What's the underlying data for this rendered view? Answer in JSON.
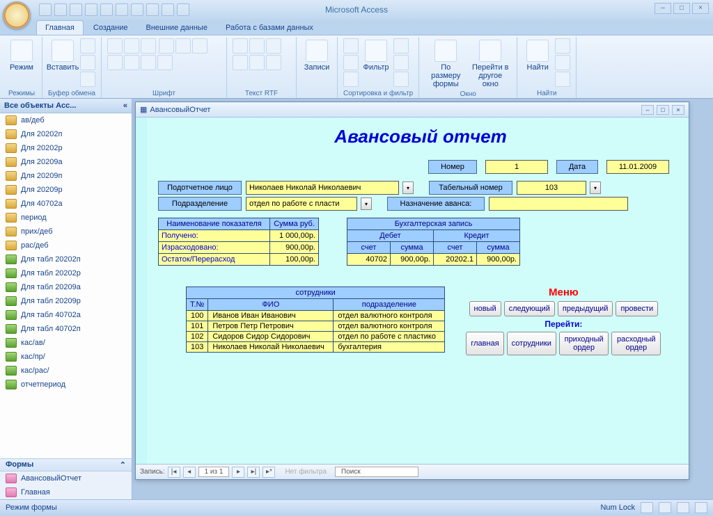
{
  "app_title": "Microsoft Access",
  "ribbon": {
    "tabs": [
      "Главная",
      "Создание",
      "Внешние данные",
      "Работа с базами данных"
    ],
    "groups": {
      "mode": {
        "btn": "Режим",
        "label": "Режимы"
      },
      "clipboard": {
        "btn": "Вставить",
        "label": "Буфер обмена"
      },
      "font": {
        "label": "Шрифт"
      },
      "rtf": {
        "label": "Текст RTF"
      },
      "records": {
        "btn": "Записи"
      },
      "sortfilter": {
        "btn": "Фильтр",
        "label": "Сортировка и фильтр"
      },
      "window": {
        "btn1": "По размеру формы",
        "btn2": "Перейти в другое окно",
        "label": "Окно"
      },
      "find": {
        "btn": "Найти",
        "label": "Найти"
      }
    }
  },
  "nav": {
    "header": "Все объекты Acc...",
    "items": [
      {
        "t": "q",
        "label": "ав/деб"
      },
      {
        "t": "q",
        "label": "Для 20202п"
      },
      {
        "t": "q",
        "label": "Для 20202р"
      },
      {
        "t": "q",
        "label": "Для 20209а"
      },
      {
        "t": "q",
        "label": "Для 20209п"
      },
      {
        "t": "q",
        "label": "Для 20209р"
      },
      {
        "t": "q",
        "label": "Для 40702а"
      },
      {
        "t": "q",
        "label": "период"
      },
      {
        "t": "q",
        "label": "прих/деб"
      },
      {
        "t": "q",
        "label": "рас/деб"
      },
      {
        "t": "g",
        "label": "Для табл 20202п"
      },
      {
        "t": "g",
        "label": "Для табл 20202р"
      },
      {
        "t": "g",
        "label": "Для табл 20209а"
      },
      {
        "t": "g",
        "label": "Для табл 20209р"
      },
      {
        "t": "g",
        "label": "Для табл 40702а"
      },
      {
        "t": "g",
        "label": "Для табл 40702п"
      },
      {
        "t": "g",
        "label": "кас/ав/"
      },
      {
        "t": "g",
        "label": "кас/пр/"
      },
      {
        "t": "g",
        "label": "кас/рас/"
      },
      {
        "t": "g",
        "label": "отчетпериод"
      }
    ],
    "forms_group": "Формы",
    "forms": [
      "АвансовыйОтчет",
      "Главная"
    ]
  },
  "form": {
    "window_title": "АвансовыйОтчет",
    "title": "Авансовый отчет",
    "labels": {
      "number": "Номер",
      "date": "Дата",
      "person": "Подотчетное лицо",
      "tabnum": "Табельный номер",
      "dept": "Подразделение",
      "purpose": "Назначение аванса:"
    },
    "values": {
      "number": "1",
      "date": "11.01.2009",
      "person": "Николаев Николай Николаевич",
      "tabnum": "103",
      "dept": "отдел по работе с пласти",
      "purpose": ""
    },
    "summary": {
      "headers": [
        "Наименование показателя",
        "Сумма руб."
      ],
      "rows": [
        [
          "Получено:",
          "1 000,00р."
        ],
        [
          "Израсходовано:",
          "900,00р."
        ],
        [
          "Остаток/Перерасход",
          "100,00р."
        ]
      ]
    },
    "accounting": {
      "title": "Бухгалтерская запись",
      "debit": "Дебет",
      "credit": "Кредит",
      "acct": "счет",
      "sum": "сумма",
      "row": [
        "40702",
        "900,00р.",
        "20202.1",
        "900,00р."
      ]
    },
    "employees": {
      "title": "сотрудники",
      "headers": [
        "Т.№",
        "ФИО",
        "подразделение"
      ],
      "rows": [
        [
          "100",
          "Иванов Иван Иванович",
          "отдел валютного контроля"
        ],
        [
          "101",
          "Петров Петр Петрович",
          "отдел валютного контроля"
        ],
        [
          "102",
          "Сидоров Сидор Сидорович",
          "отдел по работе с пластико"
        ],
        [
          "103",
          "Николаев Николай Николаевич",
          "бухгалтерия"
        ]
      ]
    },
    "menu": {
      "title": "Меню",
      "goto": "Перейти:",
      "row1": [
        "новый",
        "следующий",
        "предыдущий",
        "провести"
      ],
      "row2": [
        "главная",
        "сотрудники",
        "приходный ордер",
        "расходный ордер"
      ]
    },
    "recnav": {
      "label": "Запись:",
      "pos": "1 из 1",
      "nofilter": "Нет фильтра",
      "search": "Поиск"
    }
  },
  "statusbar": {
    "left": "Режим формы",
    "numlock": "Num Lock"
  }
}
